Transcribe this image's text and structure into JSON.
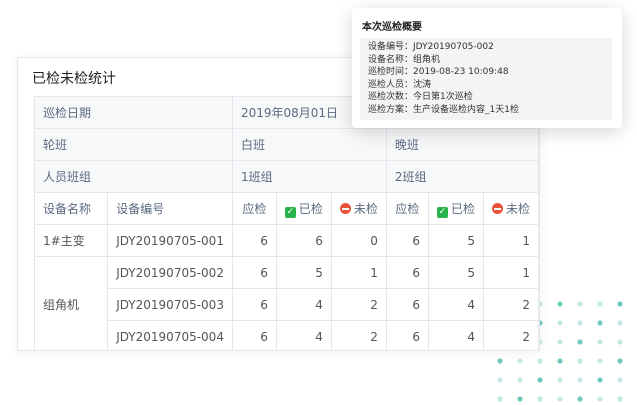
{
  "card": {
    "title": "已检未检统计"
  },
  "table": {
    "date_label": "巡检日期",
    "date_value": "2019年08月01日",
    "shift_label": "轮班",
    "shift_day": "白班",
    "shift_night": "晚班",
    "group_label": "人员班组",
    "group_day": "1班组",
    "group_night": "2班组",
    "headers": {
      "device_name": "设备名称",
      "device_code": "设备编号",
      "should": "应检",
      "checked": "已检",
      "unchecked": "未检"
    },
    "rows": [
      {
        "name": "1#主变",
        "code": "JDY20190705-001",
        "d_should": "6",
        "d_checked": "6",
        "d_unchecked": "0",
        "n_should": "6",
        "n_checked": "5",
        "n_unchecked": "1"
      },
      {
        "name": "组角机",
        "code": "JDY20190705-002",
        "d_should": "6",
        "d_checked": "5",
        "d_unchecked": "1",
        "n_should": "6",
        "n_checked": "5",
        "n_unchecked": "1"
      },
      {
        "name": "",
        "code": "JDY20190705-003",
        "d_should": "6",
        "d_checked": "4",
        "d_unchecked": "2",
        "n_should": "6",
        "n_checked": "4",
        "n_unchecked": "2"
      },
      {
        "name": "",
        "code": "JDY20190705-004",
        "d_should": "6",
        "d_checked": "4",
        "d_unchecked": "2",
        "n_should": "6",
        "n_checked": "4",
        "n_unchecked": "2"
      }
    ]
  },
  "popup": {
    "title": "本次巡检概要",
    "lines": [
      "设备编号：JDY20190705-002",
      "设备名称：组角机",
      "巡检时间：2019-08-23 10:09:48",
      "巡检人员：沈涛",
      "巡检次数：今日第1次巡检",
      "巡检方案：生产设备巡检内容_1天1检"
    ]
  },
  "colors": {
    "check_green": "#2bb34b",
    "minus_red": "#e8503a",
    "dot_teal": "#56c2b5"
  }
}
